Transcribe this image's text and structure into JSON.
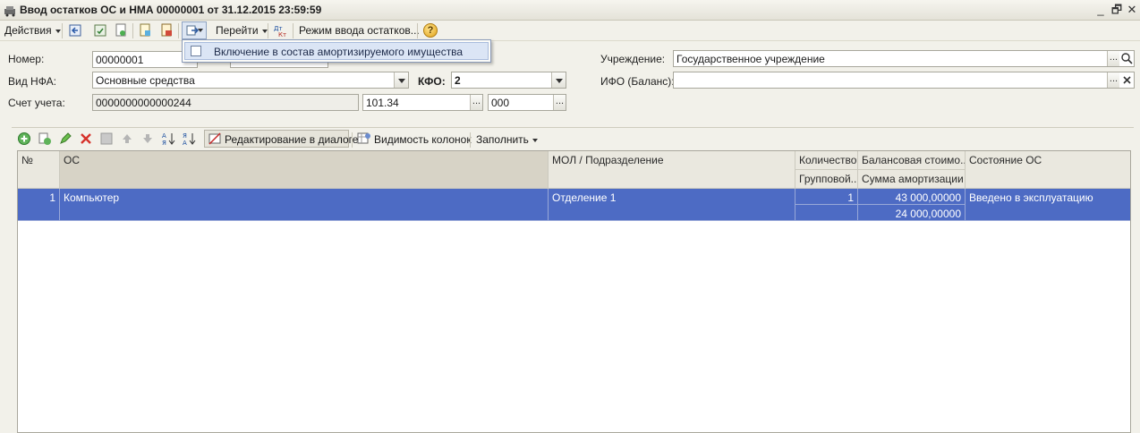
{
  "window": {
    "title": "Ввод остатков ОС и НМА 00000001 от 31.12.2015 23:59:59",
    "minimize": "_",
    "restore": "🗗",
    "close": "✕"
  },
  "toolbar": {
    "actions_label": "Действия",
    "goto_label": "Перейти",
    "mode_label": "Режим ввода остатков...",
    "help_label": "?"
  },
  "dropdown": {
    "items": [
      {
        "label": "Включение в состав амортизируемого имущества"
      }
    ]
  },
  "form": {
    "number_label": "Номер:",
    "number_value": "00000001",
    "nfa_label": "Вид НФА:",
    "nfa_value": "Основные средства",
    "kfo_label": "КФО:",
    "kfo_value": "2",
    "account_label": "Счет учета:",
    "account_value": "0000000000000244",
    "account_sub1": "101.34",
    "account_sub2": "000",
    "institution_label": "Учреждение:",
    "institution_value": "Государственное учреждение",
    "ifo_label": "ИФО (Баланс):",
    "ifo_value": "",
    "dots": "..."
  },
  "table_toolbar": {
    "edit_dialog_label": "Редактирование в диалоге",
    "columns_visibility_label": "Видимость колонок",
    "fill_label": "Заполнить"
  },
  "table": {
    "headers": {
      "num": "№",
      "os": "ОС",
      "mol": "МОЛ / Подразделение",
      "qty": "Количество",
      "qty_sub": "Групповой...",
      "balance": "Балансовая стоимо...",
      "balance_sub": "Сумма амортизации",
      "state": "Состояние ОС"
    },
    "rows": [
      {
        "num": "1",
        "os": "Компьютер",
        "mol": "Отделение 1",
        "qty": "1",
        "qty_sub": "",
        "balance": "43 000,00000",
        "amortization": "24 000,00000",
        "state": "Введено в эксплуатацию"
      }
    ]
  },
  "colors": {
    "selection": "#4d6bc4",
    "background": "#f2f1ea"
  }
}
